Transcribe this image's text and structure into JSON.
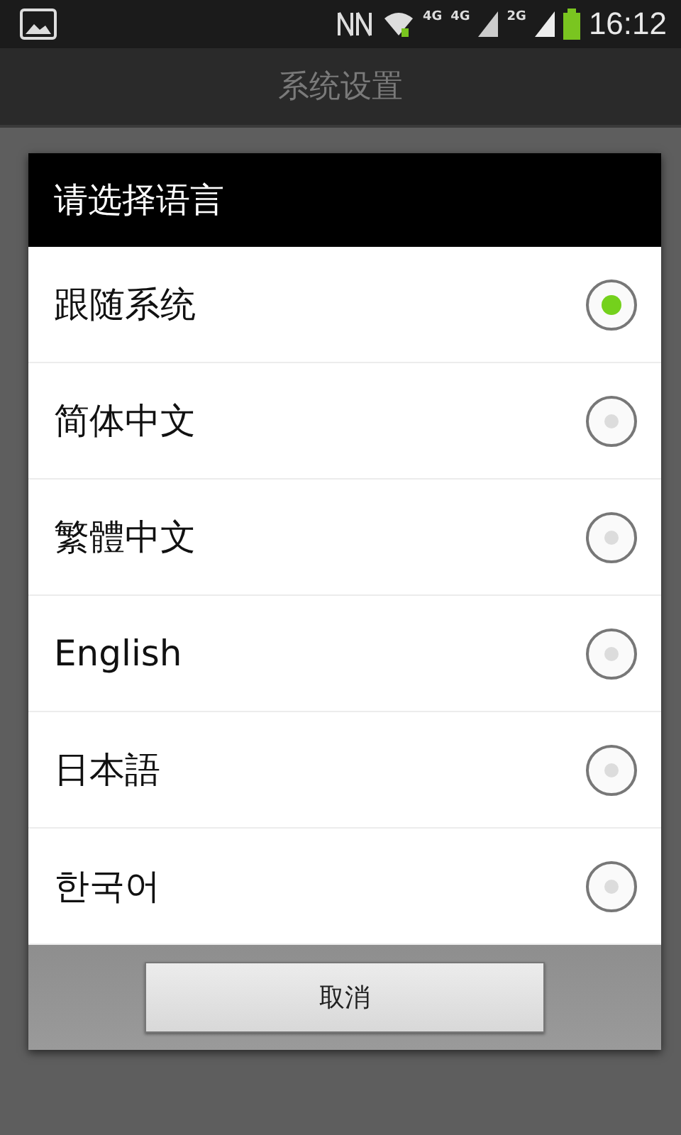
{
  "status_bar": {
    "network_labels": [
      "4G",
      "4G",
      "2G"
    ],
    "time": "16:12"
  },
  "app_bar": {
    "title": "系统设置"
  },
  "dialog": {
    "title": "请选择语言",
    "options": [
      {
        "label": "跟随系统",
        "selected": true
      },
      {
        "label": "简体中文",
        "selected": false
      },
      {
        "label": "繁體中文",
        "selected": false
      },
      {
        "label": "English",
        "selected": false
      },
      {
        "label": "日本語",
        "selected": false
      },
      {
        "label": "한국어",
        "selected": false
      }
    ],
    "cancel": "取消"
  }
}
